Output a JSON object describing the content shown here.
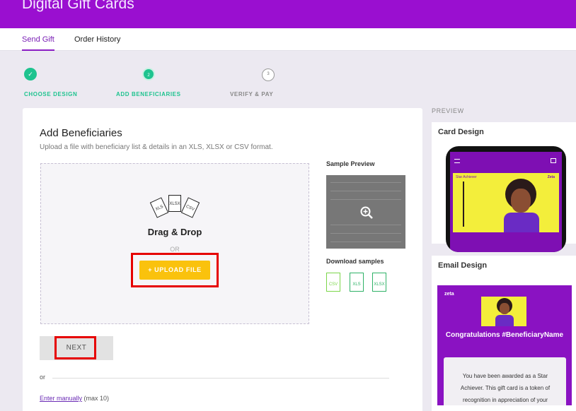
{
  "app": {
    "title": "Digital Gift Cards"
  },
  "tabs": [
    {
      "label": "Send Gift",
      "active": true
    },
    {
      "label": "Order History",
      "active": false
    }
  ],
  "steps": [
    {
      "number": "✓",
      "label": "CHOOSE DESIGN",
      "state": "done"
    },
    {
      "number": "2",
      "label": "ADD BENEFICIARIES",
      "state": "current"
    },
    {
      "number": "3",
      "label": "VERIFY & PAY",
      "state": "todo"
    }
  ],
  "main": {
    "title": "Add Beneficiaries",
    "subtitle": "Upload a file with beneficiary list & details in an XLS, XLSX or CSV format.",
    "dropzone": {
      "file_types": [
        "XLS",
        "XLSX",
        "CSV"
      ],
      "title": "Drag & Drop",
      "or": "OR",
      "upload_label": "+ UPLOAD FILE"
    },
    "sample_preview_title": "Sample Preview",
    "download_samples_title": "Download samples",
    "download_files": [
      "CSV",
      "XLS",
      "XLSX"
    ],
    "next_label": "NEXT",
    "or_label": "or",
    "enter_manually_label": "Enter manually",
    "enter_manually_note": "(max 10)"
  },
  "preview": {
    "label": "PREVIEW",
    "card_design_title": "Card Design",
    "email_design_title": "Email Design",
    "phone_brand": "Zeta",
    "phone_badge": "Star Achiever",
    "email_brand": "zeta",
    "email_heading": "Congratulations #BeneficiaryName",
    "email_body": "You have been awarded as a Star Achiever. This gift card is a token of recognition in appreciation of your dedicated service at #CorporateName."
  },
  "colors": {
    "brand": "#9a0fd0",
    "accent_green": "#1ec38f",
    "upload_yellow": "#fac20d",
    "highlight_red": "#e60000"
  }
}
